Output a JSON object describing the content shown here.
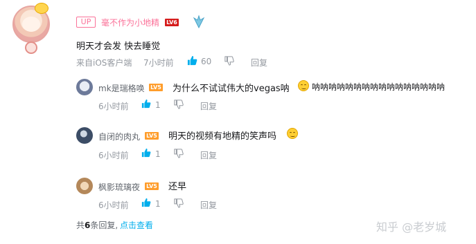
{
  "main_comment": {
    "up_badge": "UP",
    "username": "毫不作为小地精",
    "level": "LV6",
    "text": "明天才会发 快去睡觉",
    "source": "来自iOS客户端",
    "time": "7小时前",
    "likes": "60",
    "reply_label": "回复",
    "colors": {
      "name": "#fb7299",
      "level": "#d51b1b"
    }
  },
  "replies": [
    {
      "username": "mk是瑞格唤",
      "level": "LV5",
      "text": "为什么不试试伟大的vegas呐",
      "text_suffix": "呐呐呐呐呐呐呐呐呐呐呐呐呐呐呐呐",
      "emoji": "smile-emoji",
      "time": "6小时前",
      "likes": "1",
      "reply_label": "回复"
    },
    {
      "username": "自闭的肉丸",
      "level": "LV5",
      "text": "明天的视频有地精的笑声吗",
      "emoji": "smile-emoji",
      "time": "6小时前",
      "likes": "1",
      "reply_label": "回复"
    },
    {
      "username": "枫影琉璃夜",
      "level": "LV5",
      "text": "还早",
      "time": "6小时前",
      "likes": "1",
      "reply_label": "回复"
    }
  ],
  "footer": {
    "total_prefix": "共",
    "total_count": "6",
    "total_suffix": "条回复,",
    "view_link": "点击查看"
  },
  "watermark": "知乎 @老岁城",
  "colors": {
    "accent_pink": "#fb7299",
    "link_blue": "#00aeec",
    "muted": "#9499a0",
    "like_blue": "#00aeec"
  }
}
